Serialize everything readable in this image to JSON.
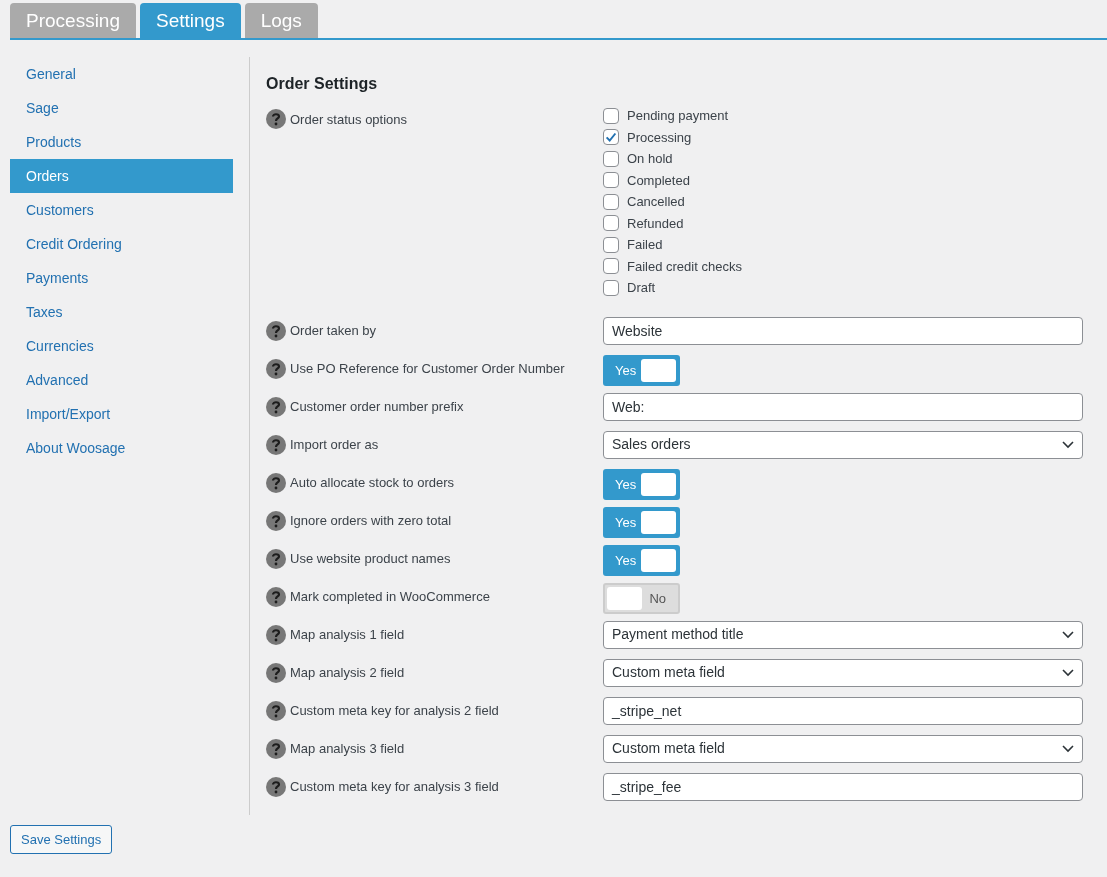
{
  "tabs": [
    {
      "label": "Processing",
      "selected": false
    },
    {
      "label": "Settings",
      "selected": true
    },
    {
      "label": "Logs",
      "selected": false
    }
  ],
  "sidebar": {
    "items": [
      {
        "label": "General",
        "selected": false
      },
      {
        "label": "Sage",
        "selected": false
      },
      {
        "label": "Products",
        "selected": false
      },
      {
        "label": "Orders",
        "selected": true
      },
      {
        "label": "Customers",
        "selected": false
      },
      {
        "label": "Credit Ordering",
        "selected": false
      },
      {
        "label": "Payments",
        "selected": false
      },
      {
        "label": "Taxes",
        "selected": false
      },
      {
        "label": "Currencies",
        "selected": false
      },
      {
        "label": "Advanced",
        "selected": false
      },
      {
        "label": "Import/Export",
        "selected": false
      },
      {
        "label": "About Woosage",
        "selected": false
      }
    ]
  },
  "section_title": "Order Settings",
  "settings": [
    {
      "kind": "checklist",
      "label": "Order status options",
      "options": [
        {
          "label": "Pending payment",
          "checked": false
        },
        {
          "label": "Processing",
          "checked": true
        },
        {
          "label": "On hold",
          "checked": false
        },
        {
          "label": "Completed",
          "checked": false
        },
        {
          "label": "Cancelled",
          "checked": false
        },
        {
          "label": "Refunded",
          "checked": false
        },
        {
          "label": "Failed",
          "checked": false
        },
        {
          "label": "Failed credit checks",
          "checked": false
        },
        {
          "label": "Draft",
          "checked": false
        }
      ]
    },
    {
      "kind": "text",
      "label": "Order taken by",
      "value": "Website"
    },
    {
      "kind": "toggle",
      "label": "Use PO Reference for Customer Order Number",
      "on": true,
      "state_text": "Yes"
    },
    {
      "kind": "text",
      "label": "Customer order number prefix",
      "value": "Web:"
    },
    {
      "kind": "select",
      "label": "Import order as",
      "value": "Sales orders"
    },
    {
      "kind": "toggle",
      "label": "Auto allocate stock to orders",
      "on": true,
      "state_text": "Yes"
    },
    {
      "kind": "toggle",
      "label": "Ignore orders with zero total",
      "on": true,
      "state_text": "Yes"
    },
    {
      "kind": "toggle",
      "label": "Use website product names",
      "on": true,
      "state_text": "Yes"
    },
    {
      "kind": "toggle",
      "label": "Mark completed in WooCommerce",
      "on": false,
      "state_text": "No"
    },
    {
      "kind": "select",
      "label": "Map analysis 1 field",
      "value": "Payment method title"
    },
    {
      "kind": "select",
      "label": "Map analysis 2 field",
      "value": "Custom meta field"
    },
    {
      "kind": "text",
      "label": "Custom meta key for analysis 2 field",
      "value": "_stripe_net"
    },
    {
      "kind": "select",
      "label": "Map analysis 3 field",
      "value": "Custom meta field"
    },
    {
      "kind": "text",
      "label": "Custom meta key for analysis 3 field",
      "value": "_stripe_fee"
    }
  ],
  "save_button": "Save Settings"
}
